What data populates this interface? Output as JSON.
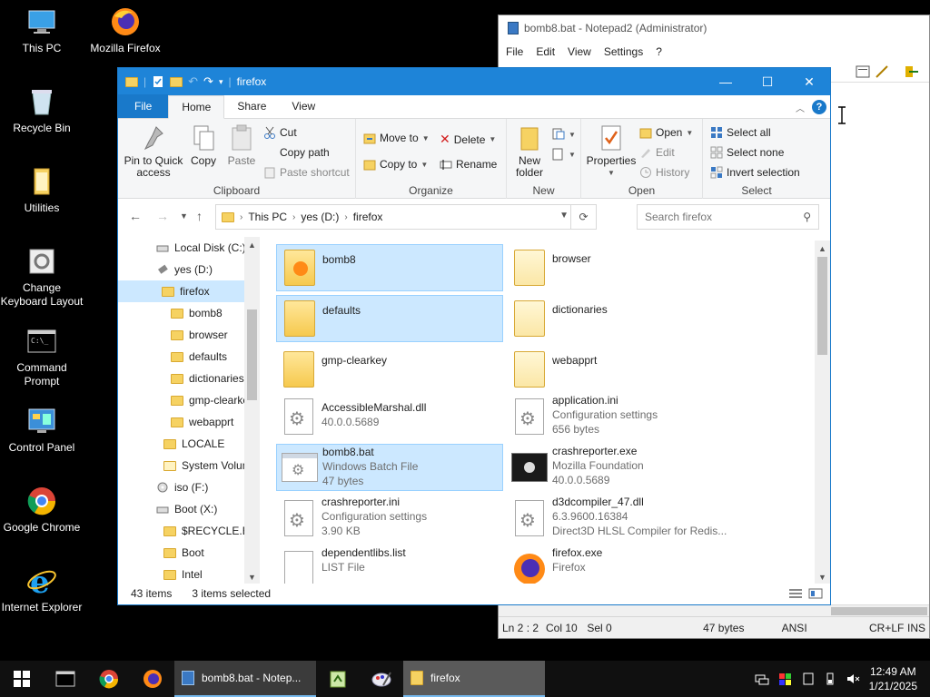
{
  "desktop": {
    "icons": [
      {
        "label": "This PC"
      },
      {
        "label": "Mozilla Firefox"
      },
      {
        "label": "Recycle Bin"
      },
      {
        "label": "Utilities"
      },
      {
        "label": "Change Keyboard Layout"
      },
      {
        "label": "Command Prompt"
      },
      {
        "label": "Control Panel"
      },
      {
        "label": "Google Chrome"
      },
      {
        "label": "Internet Explorer"
      }
    ]
  },
  "notepad": {
    "title": "bomb8.bat - Notepad2 (Administrator)",
    "menu": [
      "File",
      "Edit",
      "View",
      "Settings",
      "?"
    ],
    "status": {
      "position": "Ln 2 : 2",
      "col": "Col 10",
      "sel": "Sel 0",
      "size": "47 bytes",
      "encoding": "ANSI",
      "eol": "CR+LF",
      "mode": "INS"
    }
  },
  "explorer": {
    "title": "firefox",
    "tabs": {
      "file": "File",
      "home": "Home",
      "share": "Share",
      "view": "View"
    },
    "help": "?",
    "ribbon": {
      "clipboard": {
        "label": "Clipboard",
        "pin": "Pin to Quick access",
        "copy": "Copy",
        "paste": "Paste",
        "cut": "Cut",
        "copy_path": "Copy path",
        "paste_shortcut": "Paste shortcut"
      },
      "organize": {
        "label": "Organize",
        "move_to": "Move to",
        "copy_to": "Copy to",
        "delete": "Delete",
        "rename": "Rename"
      },
      "new": {
        "label": "New",
        "new_folder": "New folder"
      },
      "open": {
        "label": "Open",
        "properties": "Properties",
        "open": "Open",
        "edit": "Edit",
        "history": "History"
      },
      "select": {
        "label": "Select",
        "select_all": "Select all",
        "select_none": "Select none",
        "invert": "Invert selection"
      }
    },
    "address": {
      "crumbs": [
        "This PC",
        "yes (D:)",
        "firefox"
      ]
    },
    "search_placeholder": "Search firefox",
    "nav": [
      {
        "label": "Local Disk (C:)",
        "type": "drive"
      },
      {
        "label": "yes (D:)",
        "type": "usb"
      },
      {
        "label": "firefox",
        "type": "folder"
      },
      {
        "label": "bomb8",
        "type": "folder"
      },
      {
        "label": "browser",
        "type": "folder"
      },
      {
        "label": "defaults",
        "type": "folder"
      },
      {
        "label": "dictionaries",
        "type": "folder"
      },
      {
        "label": "gmp-clearkey",
        "type": "folder"
      },
      {
        "label": "webapprt",
        "type": "folder"
      },
      {
        "label": "LOCALE",
        "type": "folder"
      },
      {
        "label": "System Volume Information",
        "type": "folder"
      },
      {
        "label": "iso (F:)",
        "type": "disc"
      },
      {
        "label": "Boot (X:)",
        "type": "drive"
      },
      {
        "label": "$RECYCLE.BIN",
        "type": "folder"
      },
      {
        "label": "Boot",
        "type": "folder"
      },
      {
        "label": "Intel",
        "type": "folder"
      }
    ],
    "files": [
      {
        "name": "bomb8",
        "kind": "folder-ff",
        "selected": true
      },
      {
        "name": "browser",
        "kind": "folder-pale",
        "selected": false
      },
      {
        "name": "defaults",
        "kind": "folder",
        "selected": true
      },
      {
        "name": "dictionaries",
        "kind": "folder-pale",
        "selected": false
      },
      {
        "name": "gmp-clearkey",
        "kind": "folder",
        "selected": false
      },
      {
        "name": "webapprt",
        "kind": "folder-pale",
        "selected": false
      },
      {
        "name": "AccessibleMarshal.dll",
        "desc": "40.0.0.5689",
        "kind": "dll",
        "selected": false
      },
      {
        "name": "application.ini",
        "desc": "Configuration settings",
        "desc2": "656 bytes",
        "kind": "ini",
        "selected": false
      },
      {
        "name": "bomb8.bat",
        "desc": "Windows Batch File",
        "desc2": "47 bytes",
        "kind": "bat",
        "selected": true
      },
      {
        "name": "crashreporter.exe",
        "desc": "Mozilla Foundation",
        "desc2": "40.0.0.5689",
        "kind": "exe",
        "selected": false
      },
      {
        "name": "crashreporter.ini",
        "desc": "Configuration settings",
        "desc2": "3.90 KB",
        "kind": "ini",
        "selected": false
      },
      {
        "name": "d3dcompiler_47.dll",
        "desc": "6.3.9600.16384",
        "desc2": "Direct3D HLSL Compiler for Redis...",
        "kind": "dll",
        "selected": false
      },
      {
        "name": "dependentlibs.list",
        "desc": "LIST File",
        "kind": "doc",
        "selected": false
      },
      {
        "name": "firefox.exe",
        "desc": "Firefox",
        "kind": "ff",
        "selected": false
      }
    ],
    "status": {
      "count": "43 items",
      "selected": "3 items selected"
    }
  },
  "taskbar": {
    "tasks": [
      {
        "label": "bomb8.bat - Notep..."
      },
      {
        "label": "firefox"
      }
    ],
    "clock": {
      "time": "12:49 AM",
      "date": "1/21/2025"
    }
  }
}
